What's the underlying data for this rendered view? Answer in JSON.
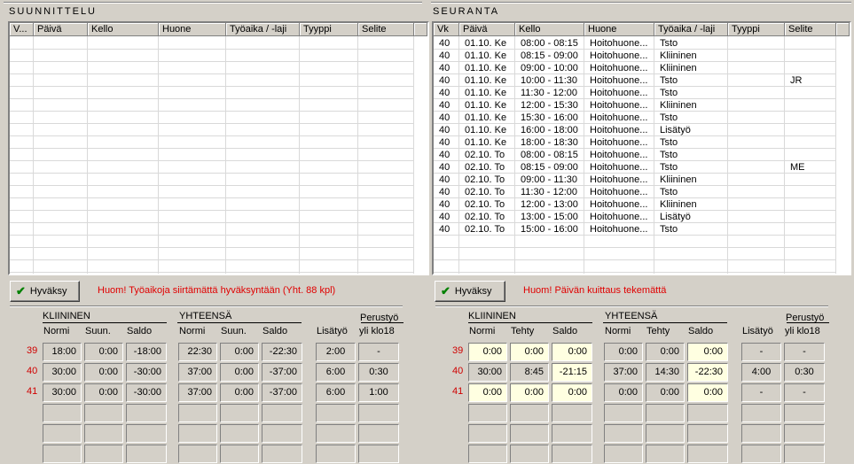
{
  "suunnittelu": {
    "title": "SUUNNITTELU",
    "columns": [
      "V...",
      "Päivä",
      "Kello",
      "Huone",
      "Työaika / -laji",
      "Tyyppi",
      "Selite"
    ],
    "approve_label": "Hyväksy",
    "warning": "Huom! Työaikoja siirtämättä hyväksyntään (Yht. 88 kpl)",
    "summary": {
      "group1": "KLIININEN",
      "group2": "YHTEENSÄ",
      "cols": [
        "Normi",
        "Suun.",
        "Saldo",
        "Normi",
        "Suun.",
        "Saldo",
        "Lisätyö",
        "Perustyö yli klo18"
      ],
      "perus1": "Perustyö",
      "perus2": "yli klo18",
      "weeks": [
        "39",
        "40",
        "41"
      ],
      "rows": [
        [
          "18:00",
          "0:00",
          "-18:00",
          "22:30",
          "0:00",
          "-22:30",
          "2:00",
          "-"
        ],
        [
          "30:00",
          "0:00",
          "-30:00",
          "37:00",
          "0:00",
          "-37:00",
          "6:00",
          "0:30"
        ],
        [
          "30:00",
          "0:00",
          "-30:00",
          "37:00",
          "0:00",
          "-37:00",
          "6:00",
          "1:00"
        ]
      ]
    }
  },
  "seuranta": {
    "title": "SEURANTA",
    "columns": [
      "Vk",
      "Päivä",
      "Kello",
      "Huone",
      "Työaika / -laji",
      "Tyyppi",
      "Selite"
    ],
    "rows": [
      [
        "40",
        "01.10. Ke",
        "08:00 - 08:15",
        "Hoitohuone...",
        "Tsto",
        "",
        ""
      ],
      [
        "40",
        "01.10. Ke",
        "08:15 - 09:00",
        "Hoitohuone...",
        "Kliininen",
        "",
        ""
      ],
      [
        "40",
        "01.10. Ke",
        "09:00 - 10:00",
        "Hoitohuone...",
        "Kliininen",
        "",
        ""
      ],
      [
        "40",
        "01.10. Ke",
        "10:00 - 11:30",
        "Hoitohuone...",
        "Tsto",
        "",
        "JR"
      ],
      [
        "40",
        "01.10. Ke",
        "11:30 - 12:00",
        "Hoitohuone...",
        "Tsto",
        "",
        ""
      ],
      [
        "40",
        "01.10. Ke",
        "12:00 - 15:30",
        "Hoitohuone...",
        "Kliininen",
        "",
        ""
      ],
      [
        "40",
        "01.10. Ke",
        "15:30 - 16:00",
        "Hoitohuone...",
        "Tsto",
        "",
        ""
      ],
      [
        "40",
        "01.10. Ke",
        "16:00 - 18:00",
        "Hoitohuone...",
        "Lisätyö",
        "",
        ""
      ],
      [
        "40",
        "01.10. Ke",
        "18:00 - 18:30",
        "Hoitohuone...",
        "Tsto",
        "",
        ""
      ],
      [
        "40",
        "02.10. To",
        "08:00 - 08:15",
        "Hoitohuone...",
        "Tsto",
        "",
        ""
      ],
      [
        "40",
        "02.10. To",
        "08:15 - 09:00",
        "Hoitohuone...",
        "Tsto",
        "",
        "ME"
      ],
      [
        "40",
        "02.10. To",
        "09:00 - 11:30",
        "Hoitohuone...",
        "Kliininen",
        "",
        ""
      ],
      [
        "40",
        "02.10. To",
        "11:30 - 12:00",
        "Hoitohuone...",
        "Tsto",
        "",
        ""
      ],
      [
        "40",
        "02.10. To",
        "12:00 - 13:00",
        "Hoitohuone...",
        "Kliininen",
        "",
        ""
      ],
      [
        "40",
        "02.10. To",
        "13:00 - 15:00",
        "Hoitohuone...",
        "Lisätyö",
        "",
        ""
      ],
      [
        "40",
        "02.10. To",
        "15:00 - 16:00",
        "Hoitohuone...",
        "Tsto",
        "",
        ""
      ]
    ],
    "approve_label": "Hyväksy",
    "warning": "Huom! Päivän kuittaus tekemättä",
    "summary": {
      "group1": "KLIININEN",
      "group2": "YHTEENSÄ",
      "cols": [
        "Normi",
        "Tehty",
        "Saldo",
        "Normi",
        "Tehty",
        "Saldo",
        "Lisätyö",
        "Perustyö yli klo18"
      ],
      "perus1": "Perustyö",
      "perus2": "yli klo18",
      "weeks": [
        "39",
        "40",
        "41"
      ],
      "rows": [
        [
          "0:00",
          "0:00",
          "0:00",
          "0:00",
          "0:00",
          "0:00",
          "-",
          "-"
        ],
        [
          "30:00",
          "8:45",
          "-21:15",
          "37:00",
          "14:30",
          "-22:30",
          "4:00",
          "0:30"
        ],
        [
          "0:00",
          "0:00",
          "0:00",
          "0:00",
          "0:00",
          "0:00",
          "-",
          "-"
        ]
      ]
    }
  }
}
